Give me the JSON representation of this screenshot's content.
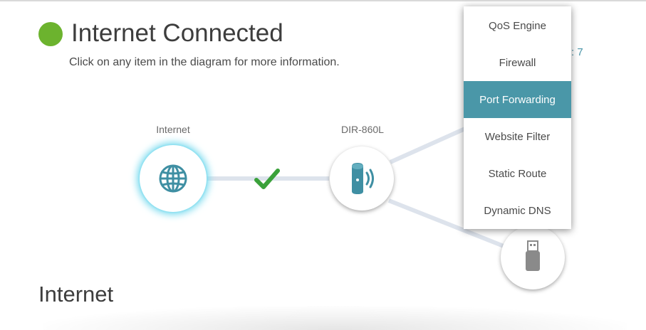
{
  "status": {
    "title": "Internet Connected",
    "subtitle": "Click on any item in the diagram for more information.",
    "color": "#6cb32e"
  },
  "clients_fragment": ": 7",
  "diagram": {
    "internet_label": "Internet",
    "router_label": "DIR-860L",
    "internet_icon": "globe-icon",
    "router_icon": "router-icon",
    "usb_icon": "usb-drive-icon",
    "connection_icon": "checkmark-icon",
    "accent": "#3f8fa3"
  },
  "section": {
    "title": "Internet"
  },
  "menu": {
    "items": [
      {
        "label": "QoS Engine"
      },
      {
        "label": "Firewall"
      },
      {
        "label": "Port Forwarding"
      },
      {
        "label": "Website Filter"
      },
      {
        "label": "Static Route"
      },
      {
        "label": "Dynamic DNS"
      }
    ],
    "active_index": 2,
    "active_color": "#4a97a8"
  }
}
